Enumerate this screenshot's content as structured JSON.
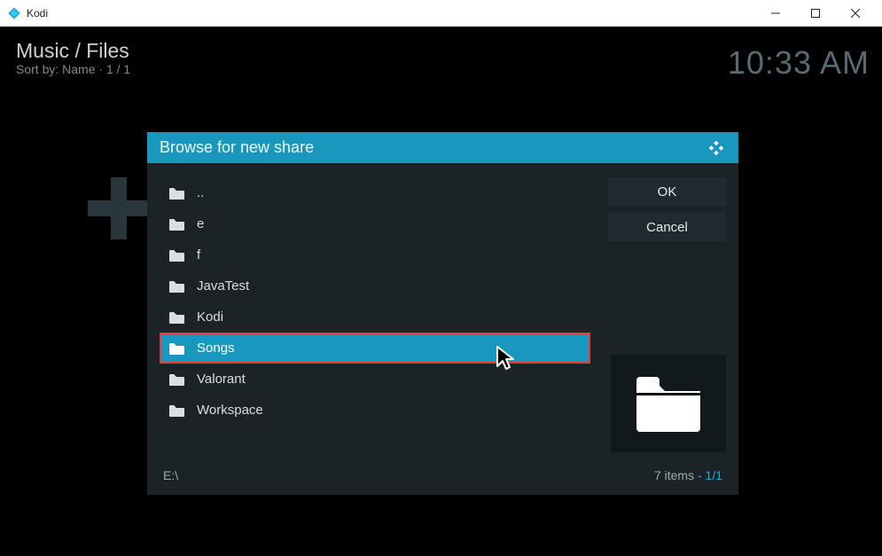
{
  "window": {
    "title": "Kodi"
  },
  "header": {
    "breadcrumb": "Music / Files",
    "sort_label": "Sort by: Name",
    "sort_separator": "·",
    "page_indicator": "1 / 1",
    "clock": "10:33 AM"
  },
  "dialog": {
    "title": "Browse for new share",
    "buttons": {
      "ok": "OK",
      "cancel": "Cancel"
    },
    "items": [
      {
        "label": "..",
        "selected": false
      },
      {
        "label": "e",
        "selected": false
      },
      {
        "label": "f",
        "selected": false
      },
      {
        "label": "JavaTest",
        "selected": false
      },
      {
        "label": "Kodi",
        "selected": false
      },
      {
        "label": "Songs",
        "selected": true
      },
      {
        "label": "Valorant",
        "selected": false
      },
      {
        "label": "Workspace",
        "selected": false
      }
    ],
    "footer": {
      "path": "E:\\",
      "count_label": "7 items",
      "separator": " - ",
      "page": "1/1"
    }
  }
}
